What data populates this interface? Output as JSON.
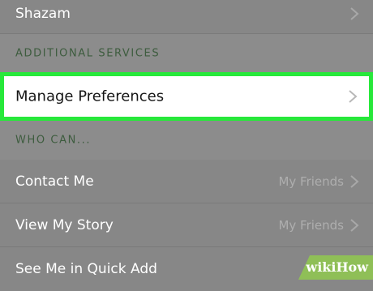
{
  "rows": {
    "shazam": {
      "label": "Shazam"
    },
    "manage_preferences": {
      "label": "Manage Preferences"
    },
    "contact_me": {
      "label": "Contact Me",
      "value": "My Friends"
    },
    "view_my_story": {
      "label": "View My Story",
      "value": "My Friends"
    },
    "see_me_quick_add": {
      "label": "See Me in Quick Add"
    }
  },
  "sections": {
    "additional_services": "ADDITIONAL SERVICES",
    "who_can": "WHO CAN..."
  },
  "icons": {
    "chevron": "chevron-right-icon"
  },
  "colors": {
    "highlight_border": "#27e83a",
    "section_header": "#3d5c3e",
    "watermark_bg": "#8fbf57"
  },
  "watermark": "wikiHow"
}
